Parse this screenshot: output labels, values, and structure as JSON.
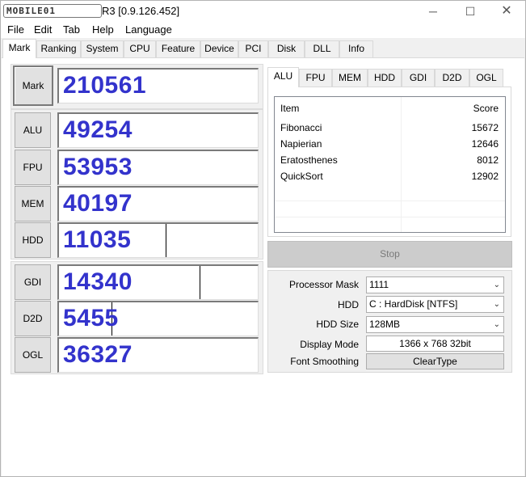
{
  "app": {
    "logo_text": "MOBILE01",
    "title": "R3 [0.9.126.452]",
    "window_controls": {
      "minimize": "─",
      "maximize": "☐",
      "close": "✕"
    }
  },
  "menu": [
    "File",
    "Edit",
    "Tab",
    "Help",
    "Language"
  ],
  "main_tabs": [
    "Mark",
    "Ranking",
    "System",
    "CPU",
    "Feature",
    "Device",
    "PCI",
    "Disk",
    "DLL",
    "Info"
  ],
  "scores": [
    {
      "label": "Mark",
      "value": "210561",
      "fill": 1.0
    },
    {
      "label": "ALU",
      "value": "49254",
      "fill": 1.0
    },
    {
      "label": "FPU",
      "value": "53953",
      "fill": 1.0
    },
    {
      "label": "MEM",
      "value": "40197",
      "fill": 1.0
    },
    {
      "label": "HDD",
      "value": "11035",
      "fill": 0.54
    },
    {
      "label": "GDI",
      "value": "14340",
      "fill": 0.71
    },
    {
      "label": "D2D",
      "value": "5455",
      "fill": 0.27
    },
    {
      "label": "OGL",
      "value": "36327",
      "fill": 1.0
    }
  ],
  "sub_tabs": [
    "ALU",
    "FPU",
    "MEM",
    "HDD",
    "GDI",
    "D2D",
    "OGL"
  ],
  "alu_table": {
    "headers": [
      "Item",
      "Score"
    ],
    "rows": [
      [
        "Fibonacci",
        "15672"
      ],
      [
        "Napierian",
        "12646"
      ],
      [
        "Eratosthenes",
        "8012"
      ],
      [
        "QuickSort",
        "12902"
      ]
    ]
  },
  "stop_label": "Stop",
  "settings": {
    "processor_mask": {
      "label": "Processor Mask",
      "value": "1111"
    },
    "hdd": {
      "label": "HDD",
      "value": "C : HardDisk [NTFS]"
    },
    "hdd_size": {
      "label": "HDD Size",
      "value": "128MB"
    },
    "display_mode": {
      "label": "Display Mode",
      "value": "1366 x 768 32bit"
    },
    "font_smoothing": {
      "label": "Font Smoothing",
      "value": "ClearType"
    }
  },
  "colors": {
    "score_text": "#3333cc",
    "window_bg": "#f0f0f0"
  },
  "icons": {
    "dropdown": "chevron-down-icon"
  }
}
